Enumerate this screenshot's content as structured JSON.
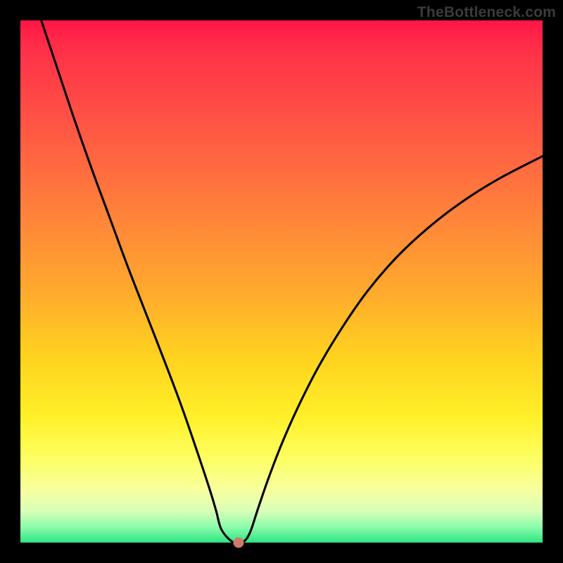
{
  "watermark": "TheBottleneck.com",
  "chart_data": {
    "type": "line",
    "title": "",
    "xlabel": "",
    "ylabel": "",
    "xlim": [
      0,
      100
    ],
    "ylim": [
      0,
      100
    ],
    "grid": false,
    "legend": false,
    "series": [
      {
        "name": "curve",
        "x": [
          4.0,
          6.5,
          10.0,
          13.5,
          17.0,
          20.5,
          24.0,
          27.5,
          31.0,
          34.5,
          36.5,
          37.5,
          38.5,
          40.5,
          41.8,
          42.8,
          44.0,
          45.5,
          47.5,
          50.0,
          53.0,
          57.0,
          61.5,
          66.5,
          72.0,
          78.0,
          84.5,
          91.5,
          100.0
        ],
        "y": [
          100.0,
          92.5,
          82.0,
          72.0,
          62.5,
          53.0,
          44.0,
          35.0,
          25.7,
          15.5,
          9.4,
          6.0,
          2.5,
          0.2,
          0.0,
          0.2,
          2.0,
          6.5,
          12.3,
          18.8,
          25.6,
          33.5,
          41.0,
          48.2,
          54.6,
          60.2,
          65.2,
          69.6,
          74.0
        ]
      }
    ],
    "marker": {
      "x": 41.8,
      "y": 0.0
    },
    "background_gradient": {
      "top": "#ff1546",
      "mid": "#fff028",
      "bottom": "#2de682"
    }
  }
}
